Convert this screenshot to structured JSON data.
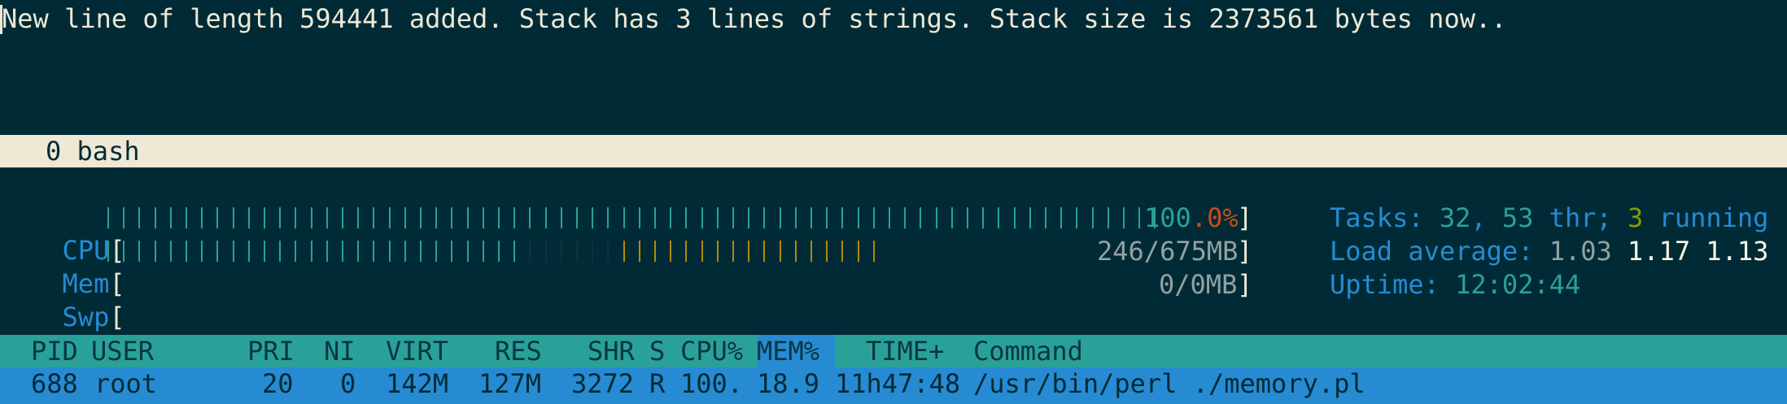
{
  "terminal": {
    "message": "New line of length 594441 added. Stack has 3 lines of strings. Stack size is 2373561 bytes now.."
  },
  "tmux": {
    "window": "0 bash"
  },
  "meters": {
    "cpu": {
      "label": "CPU",
      "value_int": "100",
      "value_frac": ".0%",
      "fraction": 1.0
    },
    "mem": {
      "label": "Mem",
      "value": "246/675MB",
      "used_fraction": 0.4,
      "buffers_fraction": 0.09,
      "cache_fraction": 0.25
    },
    "swp": {
      "label": "Swp",
      "value": "0/0MB",
      "fraction": 0.0
    }
  },
  "stats": {
    "tasks_label": "Tasks: ",
    "tasks": "32",
    "thr_sep": ", ",
    "threads": "53",
    "thr_label": " thr; ",
    "running": "3",
    "running_label": " running",
    "load_label": "Load average: ",
    "load1": "1.03",
    "load5": "1.17",
    "load15": "1.13",
    "uptime_label": "Uptime: ",
    "uptime": "12:02:44"
  },
  "table": {
    "headers": {
      "pid": "PID",
      "user": "USER",
      "pri": "PRI",
      "ni": "NI",
      "virt": "VIRT",
      "res": "RES",
      "shr": "SHR",
      "s": "S",
      "cpu": "CPU%",
      "mem": "MEM%",
      "time": "TIME+",
      "command": "Command"
    },
    "rows": [
      {
        "pid": "688",
        "user": "root",
        "pri": "20",
        "ni": "0",
        "virt": "142M",
        "res": "127M",
        "shr": "3272",
        "s": "R",
        "cpu": "100.",
        "mem": "18.9",
        "time": "11h47:48",
        "command": "/usr/bin/perl ./memory.pl"
      }
    ]
  },
  "colors": {
    "background": "#002b36",
    "cpu_bar": "#2aa198",
    "mem_used": "#2aa198",
    "mem_buffers": "#073642",
    "mem_cache": "#b58900",
    "header_bg": "#2aa198",
    "selected_row_bg": "#268bd2"
  }
}
